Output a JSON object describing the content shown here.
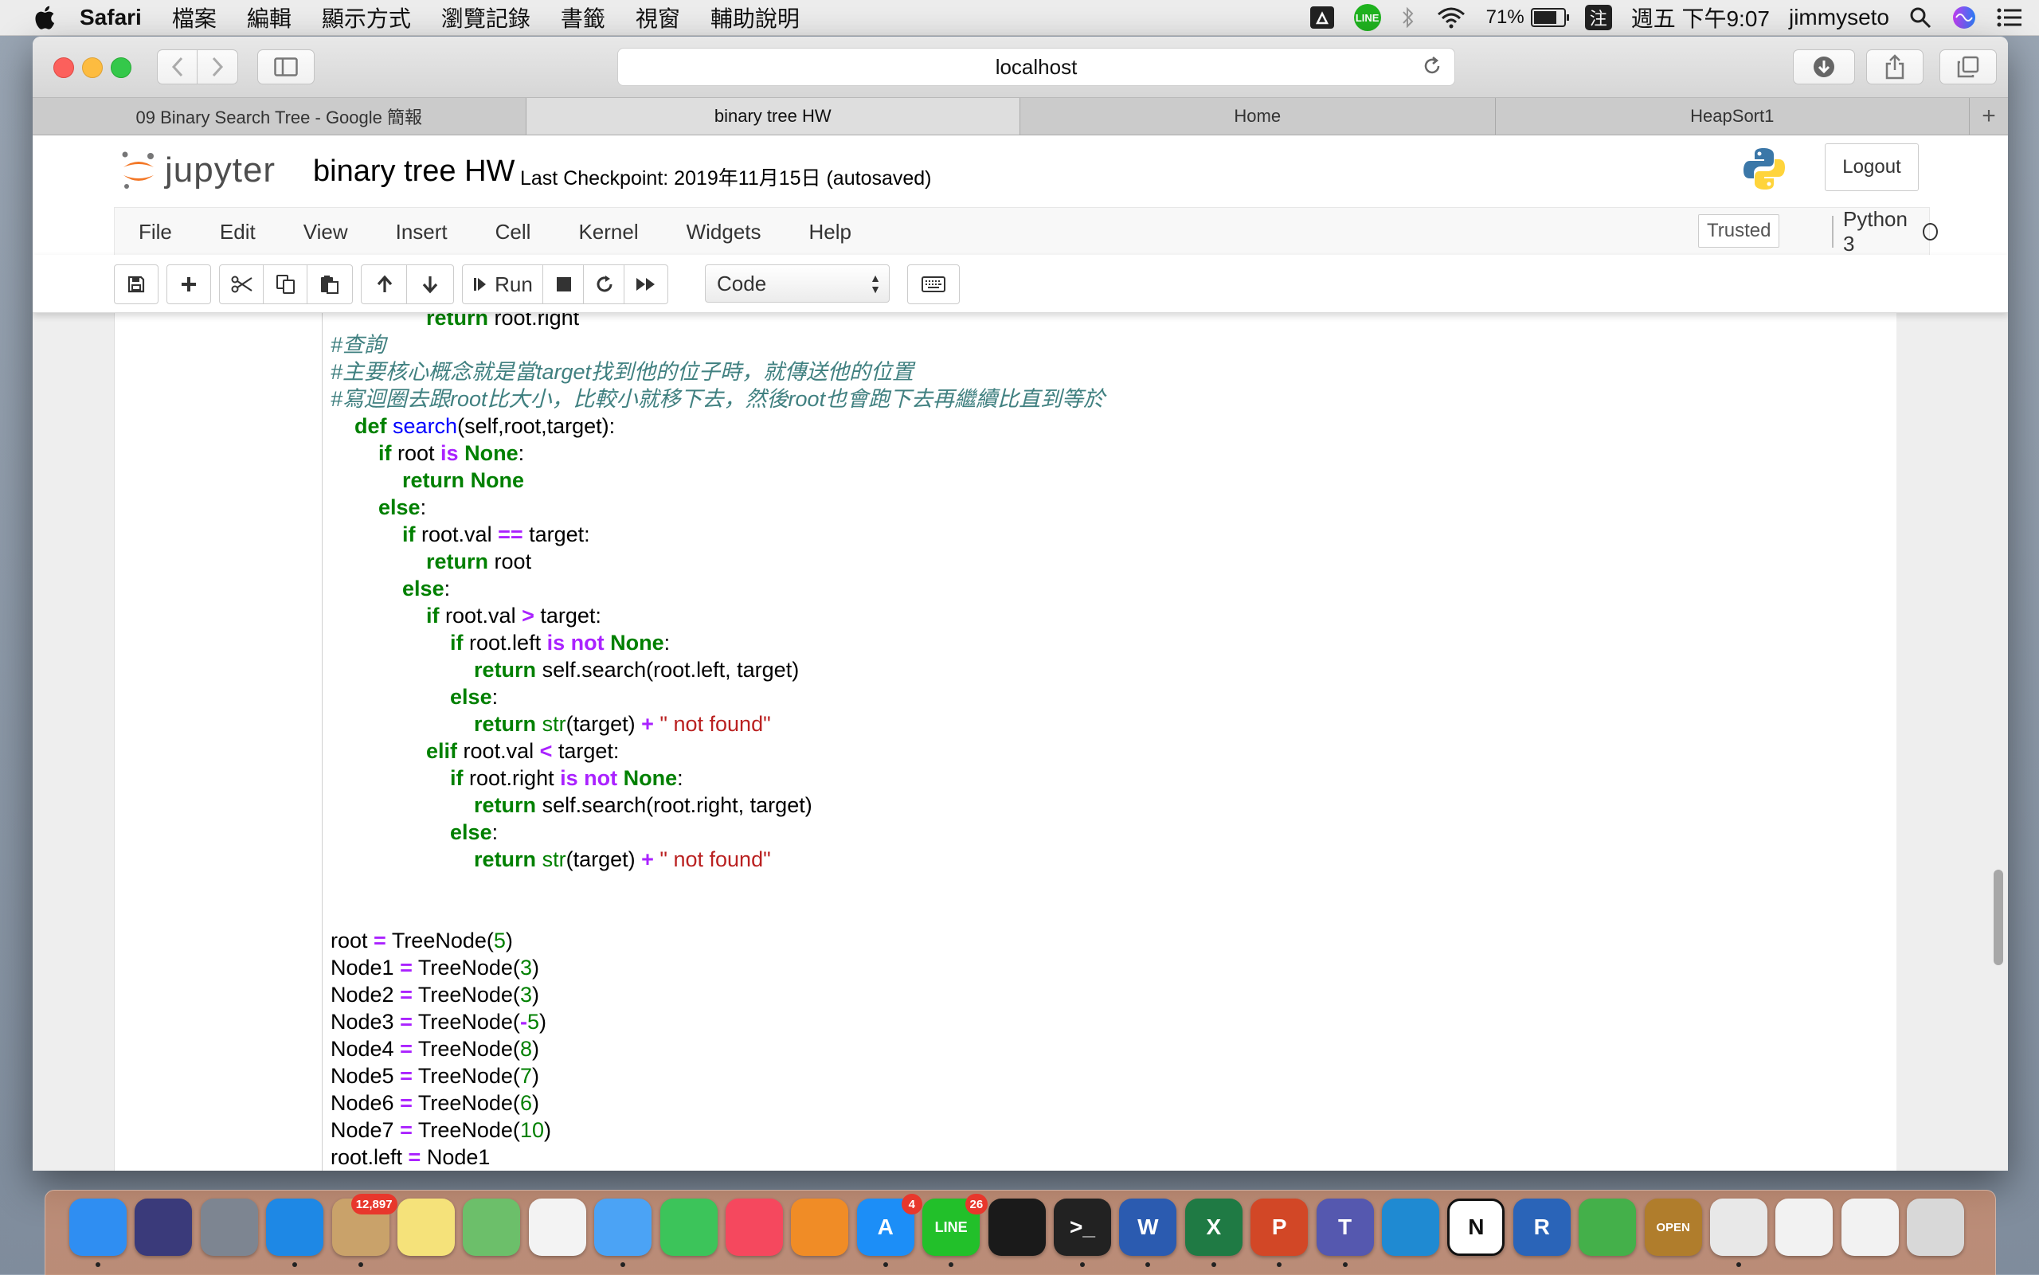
{
  "menubar": {
    "app": "Safari",
    "items": [
      "檔案",
      "編輯",
      "顯示方式",
      "瀏覽記錄",
      "書籤",
      "視窗",
      "輔助說明"
    ],
    "battery": "71%",
    "input_method": "注",
    "clock": "週五 下午9:07",
    "user": "jimmyseto",
    "line_label": "LINE"
  },
  "safari": {
    "address": "localhost",
    "tabs": [
      {
        "label": "09 Binary Search Tree - Google 簡報",
        "active": false
      },
      {
        "label": "binary tree HW",
        "active": true
      },
      {
        "label": "Home",
        "active": false
      },
      {
        "label": "HeapSort1",
        "active": false
      }
    ],
    "new_tab": "+"
  },
  "jupyter": {
    "logo_text": "jupyter",
    "title": "binary tree HW",
    "checkpoint": "Last Checkpoint: 2019年11月15日   (autosaved)",
    "logout": "Logout",
    "menu": [
      "File",
      "Edit",
      "View",
      "Insert",
      "Cell",
      "Kernel",
      "Widgets",
      "Help"
    ],
    "trusted": "Trusted",
    "kernel": "Python 3",
    "run_label": "Run",
    "cell_type": "Code"
  },
  "code_lines": [
    [
      {
        "t": "                "
      },
      {
        "t": "return",
        "c": "kw"
      },
      {
        "t": " root.right"
      }
    ],
    [
      {
        "t": "#查詢",
        "c": "cm"
      }
    ],
    [
      {
        "t": "#主要核心概念就是當target找到他的位子時，就傳送他的位置",
        "c": "cm"
      }
    ],
    [
      {
        "t": "#寫迴圈去跟root比大小，比較小就移下去，然後root也會跑下去再繼續比直到等於",
        "c": "cm"
      }
    ],
    [
      {
        "t": "    "
      },
      {
        "t": "def",
        "c": "kw"
      },
      {
        "t": " "
      },
      {
        "t": "search",
        "c": "fn"
      },
      {
        "t": "(self,root,target):"
      }
    ],
    [
      {
        "t": "        "
      },
      {
        "t": "if",
        "c": "kw"
      },
      {
        "t": " root "
      },
      {
        "t": "is",
        "c": "op"
      },
      {
        "t": " "
      },
      {
        "t": "None",
        "c": "kw"
      },
      {
        "t": ":"
      }
    ],
    [
      {
        "t": "            "
      },
      {
        "t": "return",
        "c": "kw"
      },
      {
        "t": " "
      },
      {
        "t": "None",
        "c": "kw"
      }
    ],
    [
      {
        "t": "        "
      },
      {
        "t": "else",
        "c": "kw"
      },
      {
        "t": ":"
      }
    ],
    [
      {
        "t": "            "
      },
      {
        "t": "if",
        "c": "kw"
      },
      {
        "t": " root.val "
      },
      {
        "t": "==",
        "c": "op"
      },
      {
        "t": " target:"
      }
    ],
    [
      {
        "t": "                "
      },
      {
        "t": "return",
        "c": "kw"
      },
      {
        "t": " root"
      }
    ],
    [
      {
        "t": "            "
      },
      {
        "t": "else",
        "c": "kw"
      },
      {
        "t": ":"
      }
    ],
    [
      {
        "t": "                "
      },
      {
        "t": "if",
        "c": "kw"
      },
      {
        "t": " root.val "
      },
      {
        "t": ">",
        "c": "op"
      },
      {
        "t": " target:"
      }
    ],
    [
      {
        "t": "                    "
      },
      {
        "t": "if",
        "c": "kw"
      },
      {
        "t": " root.left "
      },
      {
        "t": "is not",
        "c": "op"
      },
      {
        "t": " "
      },
      {
        "t": "None",
        "c": "kw"
      },
      {
        "t": ":"
      }
    ],
    [
      {
        "t": "                        "
      },
      {
        "t": "return",
        "c": "kw"
      },
      {
        "t": " self.search(root.left, target)"
      }
    ],
    [
      {
        "t": "                    "
      },
      {
        "t": "else",
        "c": "kw"
      },
      {
        "t": ":"
      }
    ],
    [
      {
        "t": "                        "
      },
      {
        "t": "return",
        "c": "kw"
      },
      {
        "t": " "
      },
      {
        "t": "str",
        "c": "bi"
      },
      {
        "t": "(target) "
      },
      {
        "t": "+",
        "c": "op"
      },
      {
        "t": " "
      },
      {
        "t": "\" not found\"",
        "c": "st"
      }
    ],
    [
      {
        "t": "                "
      },
      {
        "t": "elif",
        "c": "kw"
      },
      {
        "t": " root.val "
      },
      {
        "t": "<",
        "c": "op"
      },
      {
        "t": " target:"
      }
    ],
    [
      {
        "t": "                    "
      },
      {
        "t": "if",
        "c": "kw"
      },
      {
        "t": " root.right "
      },
      {
        "t": "is not",
        "c": "op"
      },
      {
        "t": " "
      },
      {
        "t": "None",
        "c": "kw"
      },
      {
        "t": ":"
      }
    ],
    [
      {
        "t": "                        "
      },
      {
        "t": "return",
        "c": "kw"
      },
      {
        "t": " self.search(root.right, target)"
      }
    ],
    [
      {
        "t": "                    "
      },
      {
        "t": "else",
        "c": "kw"
      },
      {
        "t": ":"
      }
    ],
    [
      {
        "t": "                        "
      },
      {
        "t": "return",
        "c": "kw"
      },
      {
        "t": " "
      },
      {
        "t": "str",
        "c": "bi"
      },
      {
        "t": "(target) "
      },
      {
        "t": "+",
        "c": "op"
      },
      {
        "t": " "
      },
      {
        "t": "\" not found\"",
        "c": "st"
      }
    ],
    [
      {
        "t": ""
      }
    ],
    [
      {
        "t": ""
      }
    ],
    [
      {
        "t": "root "
      },
      {
        "t": "=",
        "c": "op"
      },
      {
        "t": " TreeNode("
      },
      {
        "t": "5",
        "c": "nu"
      },
      {
        "t": ")"
      }
    ],
    [
      {
        "t": "Node1 "
      },
      {
        "t": "=",
        "c": "op"
      },
      {
        "t": " TreeNode("
      },
      {
        "t": "3",
        "c": "nu"
      },
      {
        "t": ")"
      }
    ],
    [
      {
        "t": "Node2 "
      },
      {
        "t": "=",
        "c": "op"
      },
      {
        "t": " TreeNode("
      },
      {
        "t": "3",
        "c": "nu"
      },
      {
        "t": ")"
      }
    ],
    [
      {
        "t": "Node3 "
      },
      {
        "t": "=",
        "c": "op"
      },
      {
        "t": " TreeNode("
      },
      {
        "t": "-",
        "c": "op"
      },
      {
        "t": "5",
        "c": "nu"
      },
      {
        "t": ")"
      }
    ],
    [
      {
        "t": "Node4 "
      },
      {
        "t": "=",
        "c": "op"
      },
      {
        "t": " TreeNode("
      },
      {
        "t": "8",
        "c": "nu"
      },
      {
        "t": ")"
      }
    ],
    [
      {
        "t": "Node5 "
      },
      {
        "t": "=",
        "c": "op"
      },
      {
        "t": " TreeNode("
      },
      {
        "t": "7",
        "c": "nu"
      },
      {
        "t": ")"
      }
    ],
    [
      {
        "t": "Node6 "
      },
      {
        "t": "=",
        "c": "op"
      },
      {
        "t": " TreeNode("
      },
      {
        "t": "6",
        "c": "nu"
      },
      {
        "t": ")"
      }
    ],
    [
      {
        "t": "Node7 "
      },
      {
        "t": "=",
        "c": "op"
      },
      {
        "t": " TreeNode("
      },
      {
        "t": "10",
        "c": "nu"
      },
      {
        "t": ")"
      }
    ],
    [
      {
        "t": "root.left "
      },
      {
        "t": "=",
        "c": "op"
      },
      {
        "t": " Node1"
      }
    ]
  ],
  "dock": {
    "apps": [
      {
        "name": "finder",
        "label": "",
        "color": "#2f8ef2",
        "badge": ""
      },
      {
        "name": "siri",
        "label": "",
        "color": "#3a3a7a",
        "badge": ""
      },
      {
        "name": "launchpad",
        "label": "",
        "color": "#7d8591",
        "badge": ""
      },
      {
        "name": "safari",
        "label": "",
        "color": "#1e88e5",
        "badge": ""
      },
      {
        "name": "mail",
        "label": "",
        "color": "#c9a26a",
        "badge": "12,897"
      },
      {
        "name": "notes",
        "label": "",
        "color": "#f5e27a",
        "badge": ""
      },
      {
        "name": "maps",
        "label": "",
        "color": "#6cbf6a",
        "badge": ""
      },
      {
        "name": "photos",
        "label": "",
        "color": "#f3f3f3",
        "badge": ""
      },
      {
        "name": "messages",
        "label": "",
        "color": "#4ba3f5",
        "badge": ""
      },
      {
        "name": "facetime",
        "label": "",
        "color": "#3cc45a",
        "badge": ""
      },
      {
        "name": "music",
        "label": "",
        "color": "#f5485e",
        "badge": ""
      },
      {
        "name": "books",
        "label": "",
        "color": "#f08c26",
        "badge": ""
      },
      {
        "name": "app-store",
        "label": "A",
        "color": "#1c8ef7",
        "badge": "4"
      },
      {
        "name": "line",
        "label": "LINE",
        "color": "#22c02a",
        "badge": "26"
      },
      {
        "name": "spotify",
        "label": "",
        "color": "#1a1a1a",
        "badge": ""
      },
      {
        "name": "terminal",
        "label": ">_",
        "color": "#222222",
        "badge": ""
      },
      {
        "name": "word",
        "label": "W",
        "color": "#2b5bb0",
        "badge": ""
      },
      {
        "name": "excel",
        "label": "X",
        "color": "#1f7a44",
        "badge": ""
      },
      {
        "name": "powerpoint",
        "label": "P",
        "color": "#d24726",
        "badge": ""
      },
      {
        "name": "teams",
        "label": "T",
        "color": "#5558af",
        "badge": ""
      },
      {
        "name": "vscode",
        "label": "",
        "color": "#1f8ad2",
        "badge": ""
      },
      {
        "name": "notion",
        "label": "N",
        "color": "#ffffff",
        "badge": ""
      },
      {
        "name": "r",
        "label": "R",
        "color": "#2a64b8",
        "badge": ""
      },
      {
        "name": "circle-app",
        "label": "",
        "color": "#44b04a",
        "badge": ""
      },
      {
        "name": "open-sign",
        "label": "OPEN",
        "color": "#b07d2c",
        "badge": ""
      },
      {
        "name": "chrome",
        "label": "",
        "color": "#e8e8e8",
        "badge": ""
      },
      {
        "name": "document",
        "label": "",
        "color": "#f2f2f2",
        "badge": ""
      },
      {
        "name": "excel-file",
        "label": "",
        "color": "#f2f2f2",
        "badge": ""
      },
      {
        "name": "trash",
        "label": "",
        "color": "#d8d8d8",
        "badge": ""
      }
    ]
  }
}
